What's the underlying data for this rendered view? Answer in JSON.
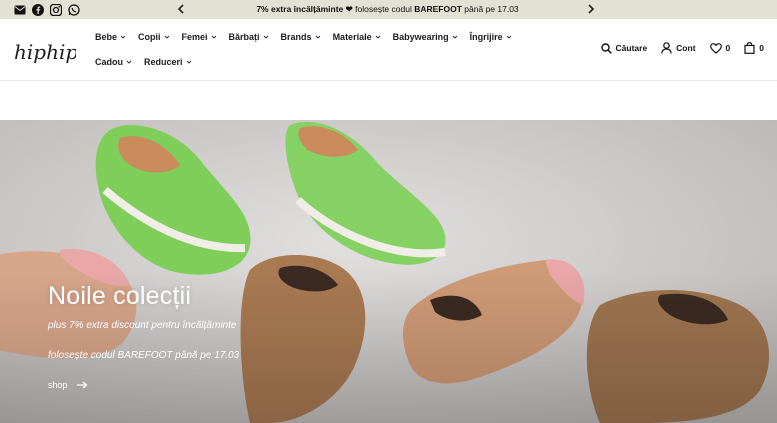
{
  "announcement": {
    "text_before": "7% extra încălțăminte",
    "heart": "❤",
    "text_mid": "folosește codul",
    "code": "BAREFOOT",
    "text_after": "până pe 17.03",
    "prev_icon": "chevron-left-icon",
    "next_icon": "chevron-right-icon"
  },
  "social": [
    "mail-icon",
    "facebook-icon",
    "instagram-icon",
    "whatsapp-icon"
  ],
  "header": {
    "logo_text": "hiphip",
    "nav": [
      {
        "label": "Bebe"
      },
      {
        "label": "Copii"
      },
      {
        "label": "Femei"
      },
      {
        "label": "Bărbați"
      },
      {
        "label": "Brands"
      },
      {
        "label": "Materiale"
      },
      {
        "label": "Babywearing"
      },
      {
        "label": "Îngrijire"
      },
      {
        "label": "Cadou"
      },
      {
        "label": "Reduceri"
      }
    ],
    "search_label": "Căutare",
    "account_label": "Cont",
    "wishlist_count": "0",
    "cart_count": "0"
  },
  "hero": {
    "title": "Noile colecții",
    "line1": "plus 7% extra discount pentru încălțăminte",
    "line2": "folosește codul BAREFOOT până pe 17.03",
    "cta": "shop"
  },
  "colors": {
    "topbar_bg": "#e3e0d4",
    "text_dark": "#1d1d1d",
    "hero_bg": "#cfcdcc",
    "shoe_green": "#7fce5a",
    "shoe_brown": "#a97a52",
    "shoe_pink": "#e9a7a7"
  }
}
